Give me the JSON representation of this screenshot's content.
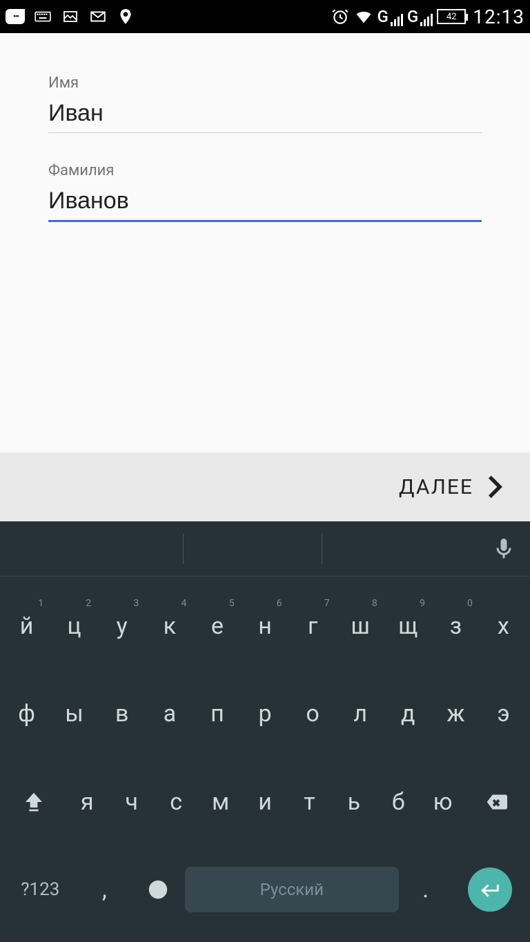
{
  "status": {
    "time": "12:13",
    "battery": "42",
    "network1": "G",
    "network2": "G"
  },
  "form": {
    "first_name_label": "Имя",
    "first_name_value": "Иван",
    "last_name_label": "Фамилия",
    "last_name_value": "Иванов"
  },
  "buttons": {
    "next": "ДАЛЕЕ"
  },
  "keyboard": {
    "symbol_key": "?123",
    "space_label": "Русский",
    "row1": [
      {
        "main": "й",
        "num": "1"
      },
      {
        "main": "ц",
        "num": "2"
      },
      {
        "main": "у",
        "num": "3"
      },
      {
        "main": "к",
        "num": "4"
      },
      {
        "main": "е",
        "num": "5"
      },
      {
        "main": "н",
        "num": "6"
      },
      {
        "main": "г",
        "num": "7"
      },
      {
        "main": "ш",
        "num": "8"
      },
      {
        "main": "щ",
        "num": "9"
      },
      {
        "main": "з",
        "num": "0"
      },
      {
        "main": "х",
        "num": ""
      }
    ],
    "row2": [
      "ф",
      "ы",
      "в",
      "а",
      "п",
      "р",
      "о",
      "л",
      "д",
      "ж",
      "э"
    ],
    "row3": [
      "я",
      "ч",
      "с",
      "м",
      "и",
      "т",
      "ь",
      "б",
      "ю"
    ],
    "comma": ",",
    "period": "."
  }
}
